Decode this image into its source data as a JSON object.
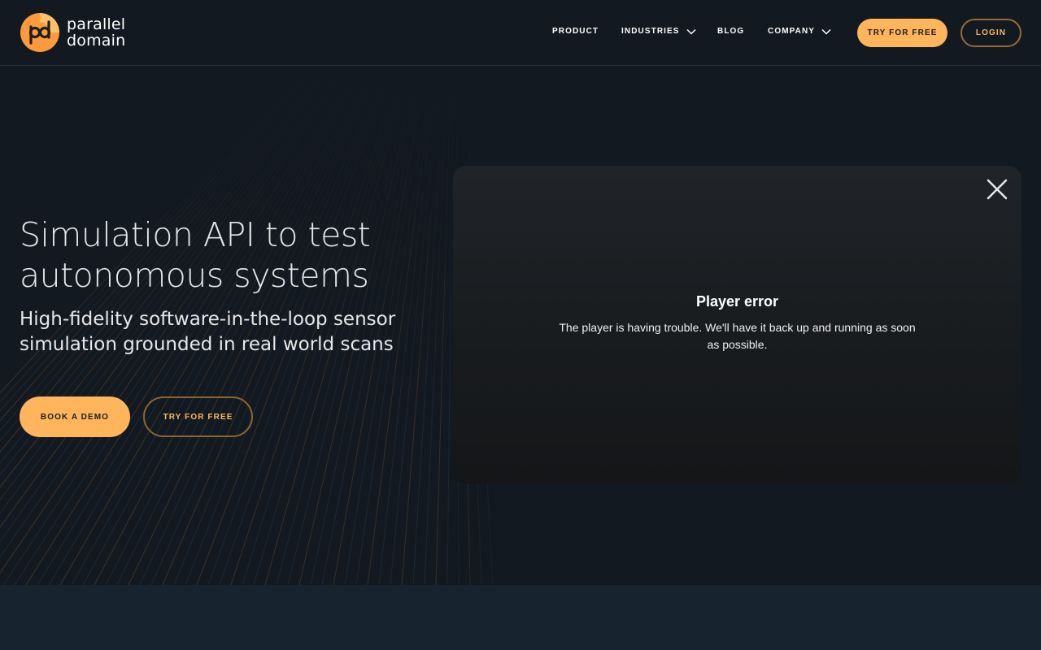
{
  "brand": {
    "name_line1": "parallel",
    "name_line2": "domain",
    "logo_mark_text": "pd",
    "accent_color": "#ffb55c"
  },
  "nav": {
    "items": [
      {
        "label": "PRODUCT",
        "has_dropdown": false
      },
      {
        "label": "INDUSTRIES",
        "has_dropdown": true
      },
      {
        "label": "BLOG",
        "has_dropdown": false
      },
      {
        "label": "COMPANY",
        "has_dropdown": true
      }
    ],
    "try_label": "TRY FOR FREE",
    "login_label": "LOGIN"
  },
  "hero": {
    "title": "Simulation API to test autonomous systems",
    "subtitle": "High-fidelity software-in-the-loop sensor simulation grounded in real world scans",
    "demo_label": "BOOK A DEMO",
    "try_label": "TRY FOR FREE"
  },
  "player": {
    "error_title": "Player error",
    "error_message": "The player is having trouble. We'll have it back up and running as soon as possible.",
    "close_icon": "close-icon"
  }
}
